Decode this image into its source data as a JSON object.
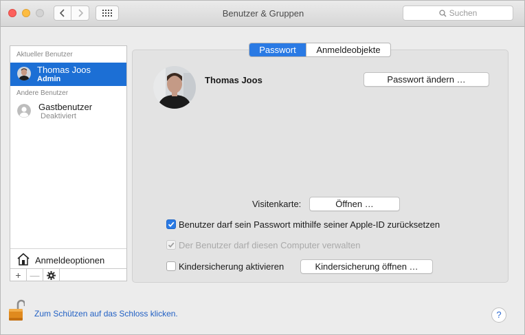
{
  "window": {
    "title": "Benutzer & Gruppen"
  },
  "toolbar": {
    "back_icon": "chevron-left-icon",
    "forward_icon": "chevron-right-icon",
    "grid_icon": "grid-icon",
    "search_placeholder": "Suchen"
  },
  "sidebar": {
    "current_header": "Aktueller Benutzer",
    "current_user": {
      "name": "Thomas Joos",
      "role": "Admin"
    },
    "other_header": "Andere Benutzer",
    "other_users": [
      {
        "name": "Gastbenutzer",
        "status": "Deaktiviert"
      }
    ],
    "login_options": "Anmeldeoptionen",
    "tools": {
      "add": "+",
      "remove": "—"
    }
  },
  "tabs": [
    {
      "label": "Passwort",
      "active": true
    },
    {
      "label": "Anmeldeobjekte",
      "active": false
    }
  ],
  "profile": {
    "name": "Thomas Joos",
    "change_password_button": "Passwort ändern …"
  },
  "contact_card": {
    "label": "Visitenkarte:",
    "button": "Öffnen …"
  },
  "options": [
    {
      "label": "Benutzer darf sein Passwort mithilfe seiner Apple-ID zurücksetzen",
      "checked": true,
      "enabled": true
    },
    {
      "label": "Der Benutzer darf diesen Computer verwalten",
      "checked": true,
      "enabled": false
    },
    {
      "label": "Kindersicherung aktivieren",
      "checked": false,
      "enabled": true
    }
  ],
  "parental_button": "Kindersicherung öffnen …",
  "footer": {
    "lock_text": "Zum Schützen auf das Schloss klicken.",
    "help": "?"
  },
  "colors": {
    "selection": "#1c6fd5",
    "accent": "#2a7ae4",
    "link": "#2160c4"
  }
}
